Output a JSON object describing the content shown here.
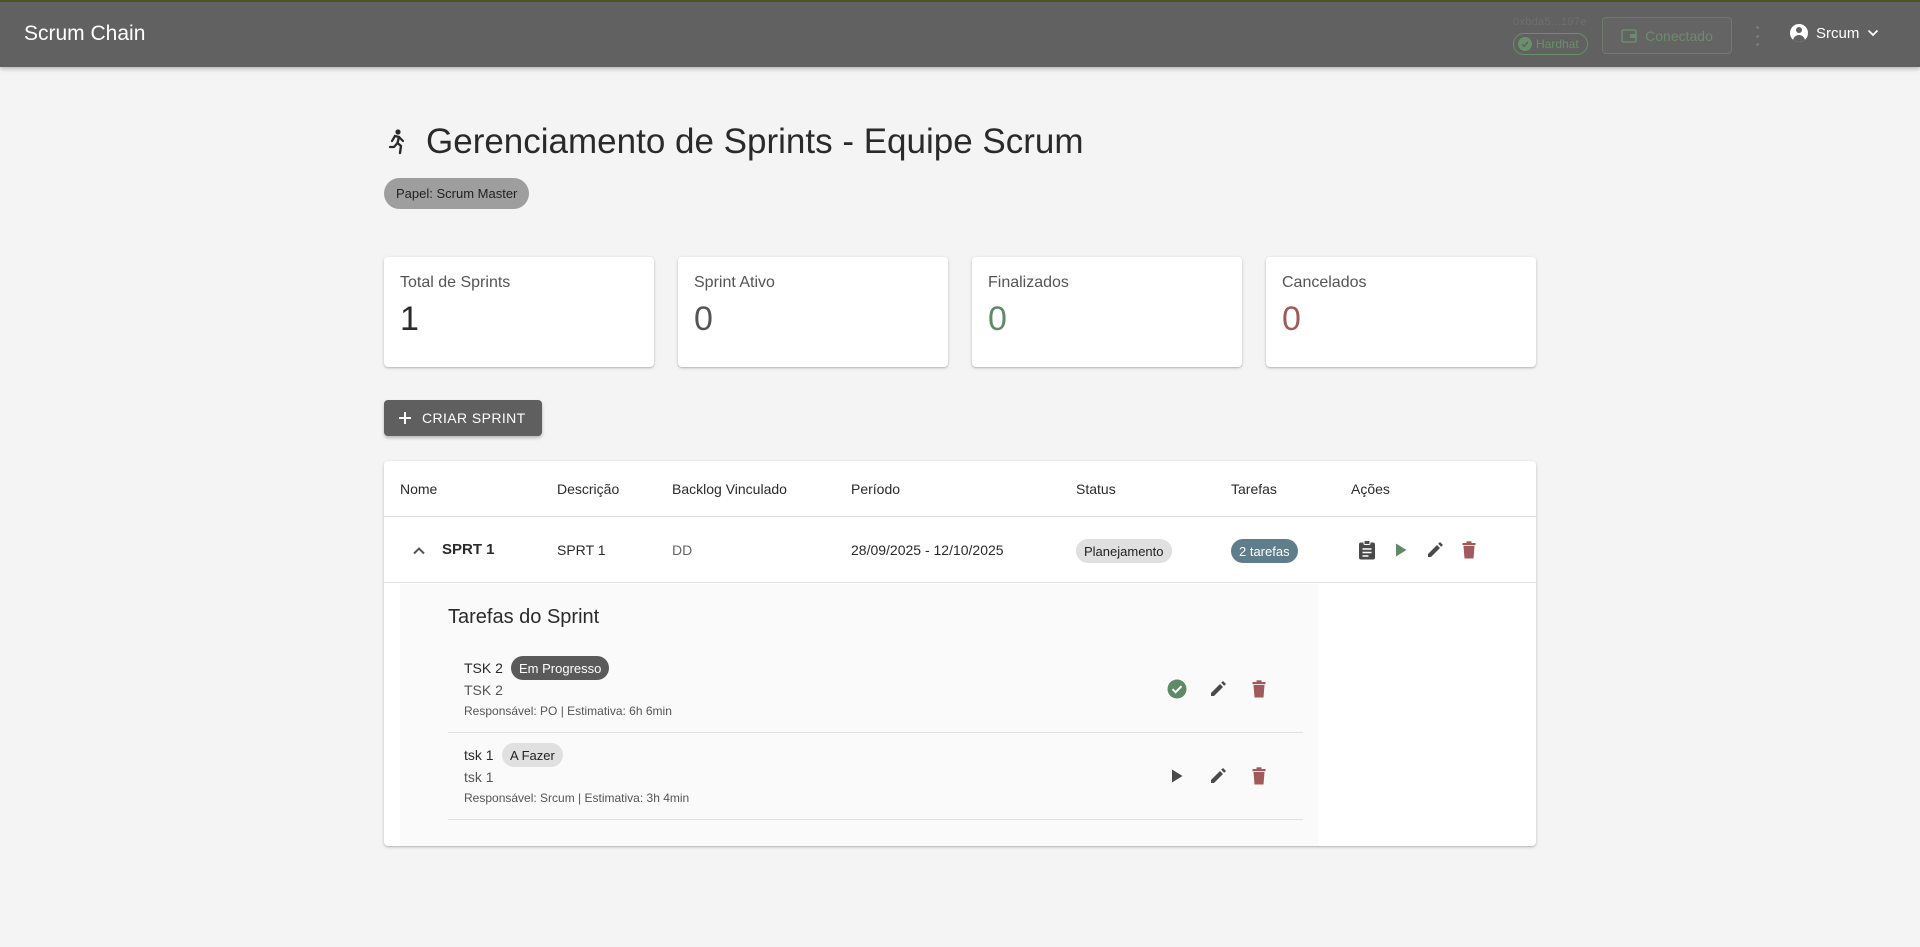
{
  "app": {
    "title": "Scrum Chain",
    "network_address": "0xbda5...197e",
    "network_chip": "Hardhat",
    "connected_label": "Conectado",
    "user_name": "Srcum"
  },
  "page": {
    "title": "Gerenciamento de Sprints - Equipe Scrum",
    "role_chip": "Papel: Scrum Master"
  },
  "stats": [
    {
      "label": "Total de Sprints",
      "value": "1",
      "color": "#2a2a2a"
    },
    {
      "label": "Sprint Ativo",
      "value": "0",
      "color": "#555555"
    },
    {
      "label": "Finalizados",
      "value": "0",
      "color": "#5e8a6a"
    },
    {
      "label": "Cancelados",
      "value": "0",
      "color": "#a05a5a"
    }
  ],
  "create_button": {
    "label": "CRIAR SPRINT"
  },
  "table": {
    "headers": [
      "Nome",
      "Descrição",
      "Backlog Vinculado",
      "Período",
      "Status",
      "Tarefas",
      "Ações"
    ],
    "rows": [
      {
        "name": "SPRT 1",
        "description": "SPRT 1",
        "backlog": "DD",
        "period": "28/09/2025 - 12/10/2025",
        "status": "Planejamento",
        "tasks": "2 tarefas"
      }
    ]
  },
  "tasks_panel": {
    "title": "Tarefas do Sprint",
    "tasks": [
      {
        "name": "TSK 2",
        "status": "Em Progresso",
        "description": "TSK 2",
        "meta": "Responsável: PO | Estimativa: 6h 6min"
      },
      {
        "name": "tsk 1",
        "status": "A Fazer",
        "description": "tsk 1",
        "meta": "Responsável: Srcum | Estimativa: 3h 4min"
      }
    ]
  },
  "colors": {
    "appbar": "#616161",
    "success": "#5e8a6a",
    "danger": "#a05a5a",
    "info": "#607d8b"
  }
}
